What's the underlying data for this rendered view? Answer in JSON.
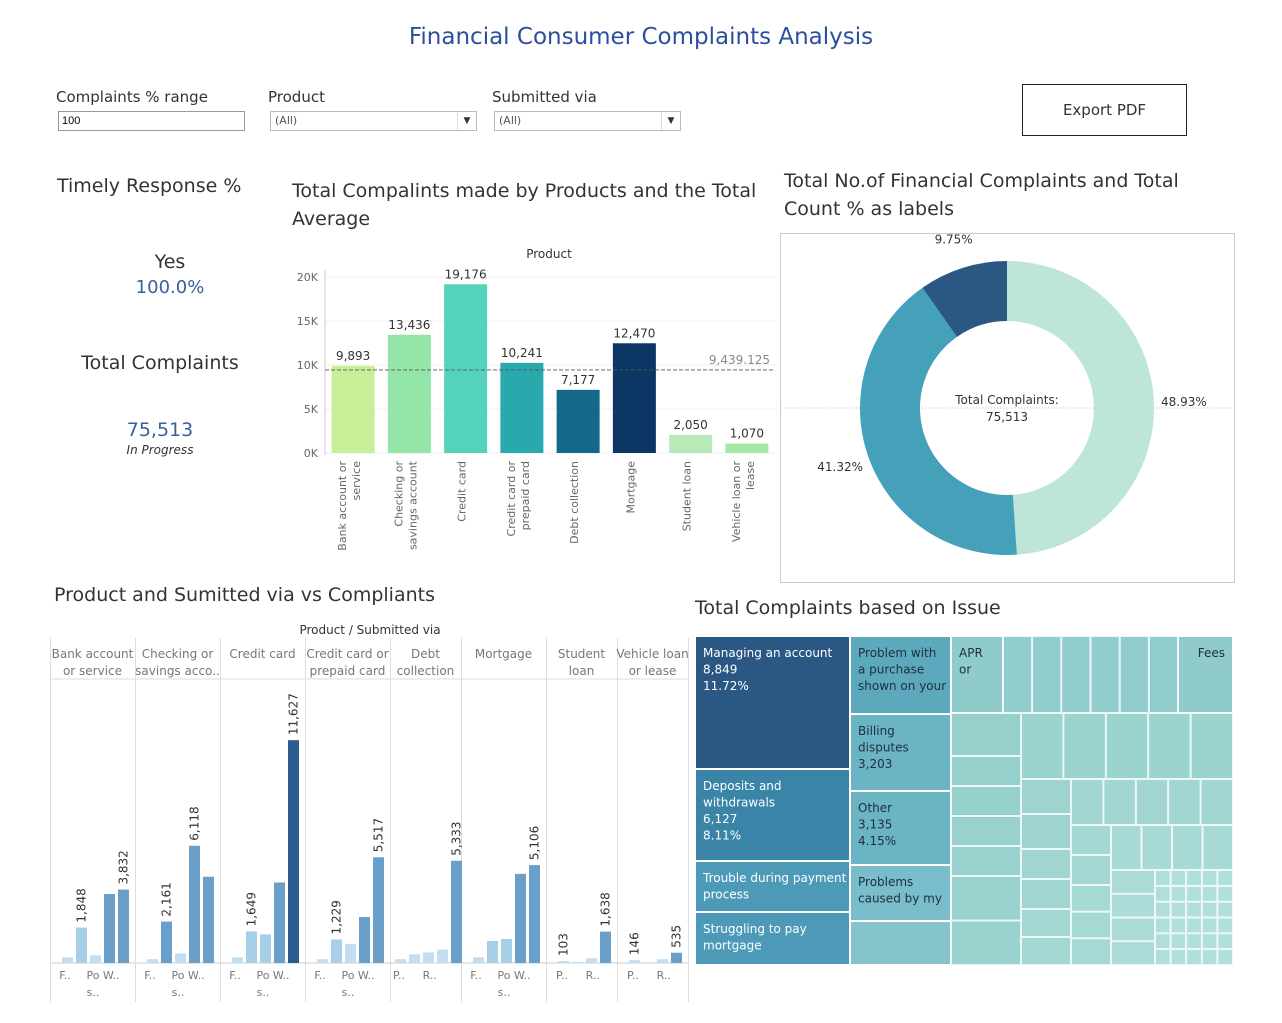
{
  "header": {
    "title": "Financial Consumer Complaints Analysis"
  },
  "filters": {
    "complaints_range_label": "Complaints % range",
    "complaints_range_value": "100",
    "product_label": "Product",
    "product_value": "(All)",
    "submitted_label": "Submitted via",
    "submitted_value": "(All)"
  },
  "export_label": "Export PDF",
  "kpi": {
    "timely_title": "Timely Response %",
    "timely_label": "Yes",
    "timely_value": "100.0%",
    "total_title": "Total Complaints",
    "total_value": "75,513",
    "total_sub": "In Progress"
  },
  "bar_section": {
    "title_line1": "Total Compalints made by Products and the Total",
    "title_line2": "Average"
  },
  "donut_section": {
    "title_line1": "Total No.of Financial Complaints and Total",
    "title_line2": "Count % as labels"
  },
  "small_section": {
    "title": "Product and Sumitted via vs Compliants"
  },
  "treemap_section": {
    "title": "Total Complaints based on Issue"
  },
  "chart_data": [
    {
      "type": "bar",
      "header": "Product",
      "categories": [
        "Bank account or service",
        "Checking or savings account",
        "Credit card",
        "Credit card or prepaid card",
        "Debt collection",
        "Mortgage",
        "Student loan",
        "Vehicle loan or lease"
      ],
      "category_lines": [
        [
          "Bank account or",
          "service"
        ],
        [
          "Checking or",
          "savings account"
        ],
        [
          "Credit card"
        ],
        [
          "Credit card or",
          "prepaid card"
        ],
        [
          "Debt collection"
        ],
        [
          "Mortgage"
        ],
        [
          "Student loan"
        ],
        [
          "Vehicle loan or",
          "lease"
        ]
      ],
      "values": [
        9893,
        13436,
        19176,
        10241,
        7177,
        12470,
        2050,
        1070
      ],
      "value_labels": [
        "9,893",
        "13,436",
        "19,176",
        "10,241",
        "7,177",
        "12,470",
        "2,050",
        "1,070"
      ],
      "colors": [
        "#c6ef97",
        "#94e6a8",
        "#54d3bb",
        "#27a9ae",
        "#14688a",
        "#0c3764",
        "#b7eab8",
        "#a4e9a4"
      ],
      "reference_line": {
        "value": 9439.125,
        "label": "9,439.125"
      },
      "yticks": [
        0,
        5000,
        10000,
        15000,
        20000
      ],
      "ytick_labels": [
        "0K",
        "5K",
        "10K",
        "15K",
        "20K"
      ],
      "ylim": [
        0,
        21000
      ]
    },
    {
      "type": "pie",
      "center_label_line1": "Total Complaints:",
      "center_label_line2": "75,513",
      "slices": [
        {
          "label": "48.93%",
          "value": 48.93,
          "color": "#bee5da"
        },
        {
          "label": "41.32%",
          "value": 41.32,
          "color": "#45a1ba"
        },
        {
          "label": "9.75%",
          "value": 9.75,
          "color": "#2a5883"
        }
      ]
    },
    {
      "type": "bar",
      "header": "Product  /  Submitted via",
      "panels": [
        {
          "lines": [
            "Bank account",
            "or service"
          ],
          "values": [
            300,
            1848,
            400,
            3600,
            3832
          ],
          "labels": [
            null,
            "1,848",
            null,
            null,
            "3,832"
          ],
          "xlabels": [
            [
              "F.."
            ],
            [
              "Po",
              "s.."
            ],
            [
              "W.."
            ]
          ]
        },
        {
          "lines": [
            "Checking or",
            "savings acco.."
          ],
          "values": [
            200,
            2161,
            500,
            6118,
            4500
          ],
          "labels": [
            null,
            "2,161",
            null,
            "6,118",
            null
          ],
          "xlabels": [
            [
              "F.."
            ],
            [
              "Po",
              "s.."
            ],
            [
              "W.."
            ]
          ]
        },
        {
          "lines": [
            "Credit card"
          ],
          "values": [
            300,
            1649,
            1500,
            4200,
            11627
          ],
          "labels": [
            null,
            "1,649",
            null,
            null,
            "11,627"
          ],
          "xlabels": [
            [
              "F.."
            ],
            [
              "Po",
              "s.."
            ],
            [
              "W.."
            ]
          ]
        },
        {
          "lines": [
            "Credit card or",
            "prepaid card"
          ],
          "values": [
            200,
            1229,
            1000,
            2400,
            5517
          ],
          "labels": [
            null,
            "1,229",
            null,
            null,
            "5,517"
          ],
          "xlabels": [
            [
              "F.."
            ],
            [
              "Po",
              "s.."
            ],
            [
              "W.."
            ]
          ]
        },
        {
          "lines": [
            "Debt",
            "collection"
          ],
          "values": [
            200,
            450,
            550,
            700,
            5333
          ],
          "labels": [
            null,
            null,
            null,
            null,
            "5,333"
          ],
          "xlabels": [
            [
              "P.."
            ],
            [
              "R.."
            ]
          ]
        },
        {
          "lines": [
            "Mortgage"
          ],
          "values": [
            300,
            1150,
            1250,
            4650,
            5106
          ],
          "labels": [
            null,
            null,
            null,
            null,
            "5,106"
          ],
          "xlabels": [
            [
              "F.."
            ],
            [
              "Po",
              "s.."
            ],
            [
              "W.."
            ]
          ]
        },
        {
          "lines": [
            "Student",
            "loan"
          ],
          "values": [
            103,
            50,
            250,
            1638
          ],
          "labels": [
            "103",
            null,
            null,
            "1,638"
          ],
          "xlabels": [
            [
              "P.."
            ],
            [
              "R.."
            ]
          ]
        },
        {
          "lines": [
            "Vehicle loan",
            "or lease"
          ],
          "values": [
            146,
            40,
            200,
            535
          ],
          "labels": [
            "146",
            null,
            null,
            "535"
          ],
          "xlabels": [
            [
              "P.."
            ],
            [
              "R.."
            ]
          ]
        }
      ],
      "ylim": [
        0,
        12500
      ]
    },
    {
      "type": "heatmap",
      "subtype": "treemap",
      "labelled_tiles": [
        {
          "lines": [
            "Managing an account",
            "8,849",
            "11.72%"
          ],
          "value": 8849,
          "color": "#2b5783"
        },
        {
          "lines": [
            "Deposits and",
            "withdrawals",
            "6,127",
            "8.11%"
          ],
          "value": 6127,
          "color": "#3a84a8"
        },
        {
          "lines": [
            "Trouble during payment",
            "process"
          ],
          "color": "#4d9ab8"
        },
        {
          "lines": [
            "Struggling to pay",
            "mortgage"
          ],
          "color": "#4d9ab8"
        },
        {
          "lines": [
            "Problem with",
            "a purchase",
            "shown on your"
          ],
          "color": "#5ca9bd"
        },
        {
          "lines": [
            "Billing",
            "disputes",
            "3,203"
          ],
          "value": 3203,
          "color": "#6ab4c3"
        },
        {
          "lines": [
            "Other",
            "3,135",
            "4.15%"
          ],
          "value": 3135,
          "color": "#6ab4c3"
        },
        {
          "lines": [
            "Problems",
            "caused by my"
          ],
          "color": "#78bdc9"
        },
        {
          "lines": [
            "APR",
            "or"
          ],
          "color": "#8fcbcb"
        },
        {
          "lines": [
            "Fees"
          ],
          "color": "#8fcbcb"
        }
      ]
    }
  ]
}
